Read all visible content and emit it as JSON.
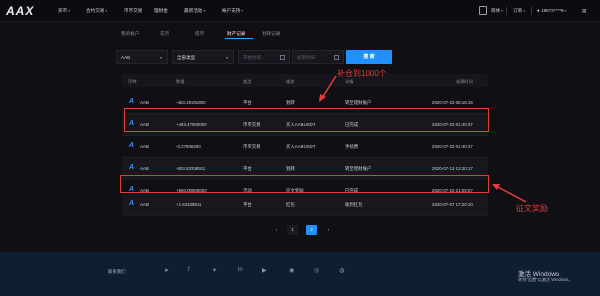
{
  "nav": {
    "logo": "AAX",
    "items": [
      "买币",
      "合约交易",
      "币币交易",
      "理财金",
      "最新活动",
      "帐户支持"
    ],
    "lang": "简体",
    "orders": "订单",
    "account": "18873****6",
    "balance_label": "余额"
  },
  "tabs": [
    "我的帐户",
    "充币",
    "提币",
    "财产记录",
    "划转记录"
  ],
  "filters": {
    "coin": "AAB",
    "type": "全部类型",
    "start_placeholder": "开始时间",
    "end_placeholder": "结束时间",
    "search_label": "搜 索"
  },
  "table": {
    "headers": [
      "币种",
      "数量",
      "类型",
      "描述",
      "详情",
      "创建时间"
    ],
    "rows": [
      {
        "coin": "AAB",
        "amount": "-463.19191800",
        "type": "平台",
        "desc": "划转",
        "detail": "转至理财账户",
        "time": "2020-07-23 08:18:15"
      },
      {
        "coin": "AAB",
        "amount": "+463.47000000",
        "type": "币币交易",
        "desc": "买入AABUSDT",
        "detail": "已完成",
        "time": "2020-07-23 01:40:37"
      },
      {
        "coin": "AAB",
        "amount": "-0.27808200",
        "type": "币币交易",
        "desc": "买入AABUSDT",
        "detail": "手续费",
        "time": "2020-07-23 01:40:37"
      },
      {
        "coin": "AAB",
        "amount": "-503.53338911",
        "type": "平台",
        "desc": "划转",
        "detail": "转至理财账户",
        "time": "2020-07-13 13:20:17"
      },
      {
        "coin": "AAB",
        "amount": "+500.00000000",
        "type": "活动",
        "desc": "征文奖励",
        "detail": "已完成",
        "time": "2020-07-10 21:09:07"
      },
      {
        "coin": "AAB",
        "amount": "+1.53338911",
        "type": "平台",
        "desc": "红包",
        "detail": "收到红包",
        "time": "2020-07-07 17:20:10"
      }
    ]
  },
  "annotations": {
    "top": "补仓到1000个",
    "right": "征文奖励"
  },
  "pagination": {
    "prev": "‹",
    "page1": "1",
    "page2": "2",
    "next": "›"
  },
  "footer": {
    "label": "联系我们",
    "activate_title": "激活 Windows",
    "activate_sub": "转到“设置”以激活 Windows。"
  },
  "colors": {
    "accent": "#1e90ff",
    "highlight": "#e43b3b",
    "background": "#101014",
    "footer": "#0f1e33"
  }
}
